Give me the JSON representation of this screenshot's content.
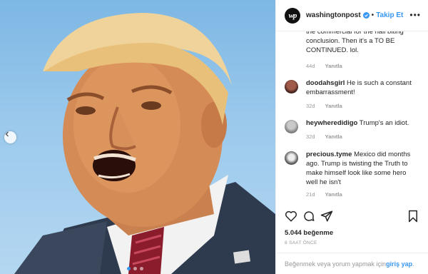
{
  "post": {
    "username": "washingtonpost",
    "avatar_text": "wp",
    "separator": "•",
    "follow_label": "Takip Et",
    "more_label": "•••",
    "likes": "5.044 beğenme",
    "time_ago": "8 SAAT ÖNCE"
  },
  "comments": [
    {
      "user": "",
      "text": "the commercial for the nail biting conclusion. Then it's a TO BE CONTINUED. lol.",
      "age": "44d",
      "reply": "Yanıtla"
    },
    {
      "user": "doodahsgirl",
      "text": "He is such a constant embarrassment!",
      "age": "32d",
      "reply": "Yanıtla"
    },
    {
      "user": "heywheredidigo",
      "text": "Trump's an idiot.",
      "age": "32d",
      "reply": "Yanıtla"
    },
    {
      "user": "precious.tyme",
      "text": "Mexico did months ago. Trump is twisting the Truth to make himself look like some hero well he isn't",
      "age": "21d",
      "reply": "Yanıtla"
    }
  ],
  "footer": {
    "prefix": "Beğenmek veya yorum yapmak için ",
    "login_label": "giriş yap",
    "suffix": "."
  },
  "carousel": {
    "count": 3,
    "active": 1
  },
  "colors": {
    "accent": "#3897f0",
    "muted": "#999999",
    "text": "#262626"
  },
  "icons": [
    "chevron-left-icon",
    "verified-badge-icon",
    "heart-icon",
    "comment-icon",
    "share-icon",
    "bookmark-icon"
  ]
}
